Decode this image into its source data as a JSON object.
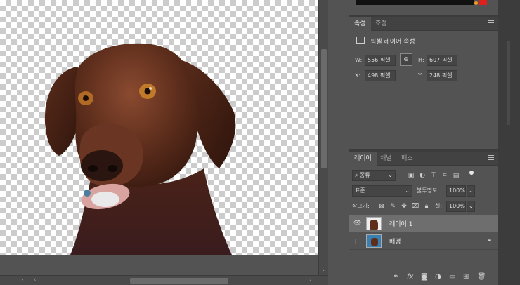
{
  "properties_panel": {
    "tabs": [
      "속성",
      "조정"
    ],
    "section_title": "픽셀 레이어 속성",
    "w_label": "W:",
    "w_value": "556 픽셀",
    "h_label": "H:",
    "h_value": "607 픽셀",
    "x_label": "X:",
    "x_value": "498 픽셀",
    "y_label": "Y:",
    "y_value": "248 픽셀"
  },
  "layers_panel": {
    "tabs": [
      "레이어",
      "채널",
      "패스"
    ],
    "filter_value": "종류",
    "blend_mode": "표준",
    "opacity_label": "불투명도:",
    "opacity_value": "100%",
    "lock_label": "잠그기:",
    "fill_label": "칠:",
    "fill_value": "100%",
    "layers": [
      {
        "name": "레이어 1",
        "visible": true,
        "selected": true
      },
      {
        "name": "배경",
        "visible": false,
        "selected": false,
        "locked": true
      }
    ],
    "footer_icons": [
      "link-icon",
      "fx-icon",
      "mask-icon",
      "adjustment-icon",
      "folder-icon",
      "new-layer-icon",
      "trash-icon"
    ]
  },
  "colors": {
    "app_bg": "#535353",
    "panel_bg": "#535353",
    "selected_layer": "#6e6e6e",
    "accent_red": "#e0201a",
    "accent_orange": "#f39a1f"
  }
}
